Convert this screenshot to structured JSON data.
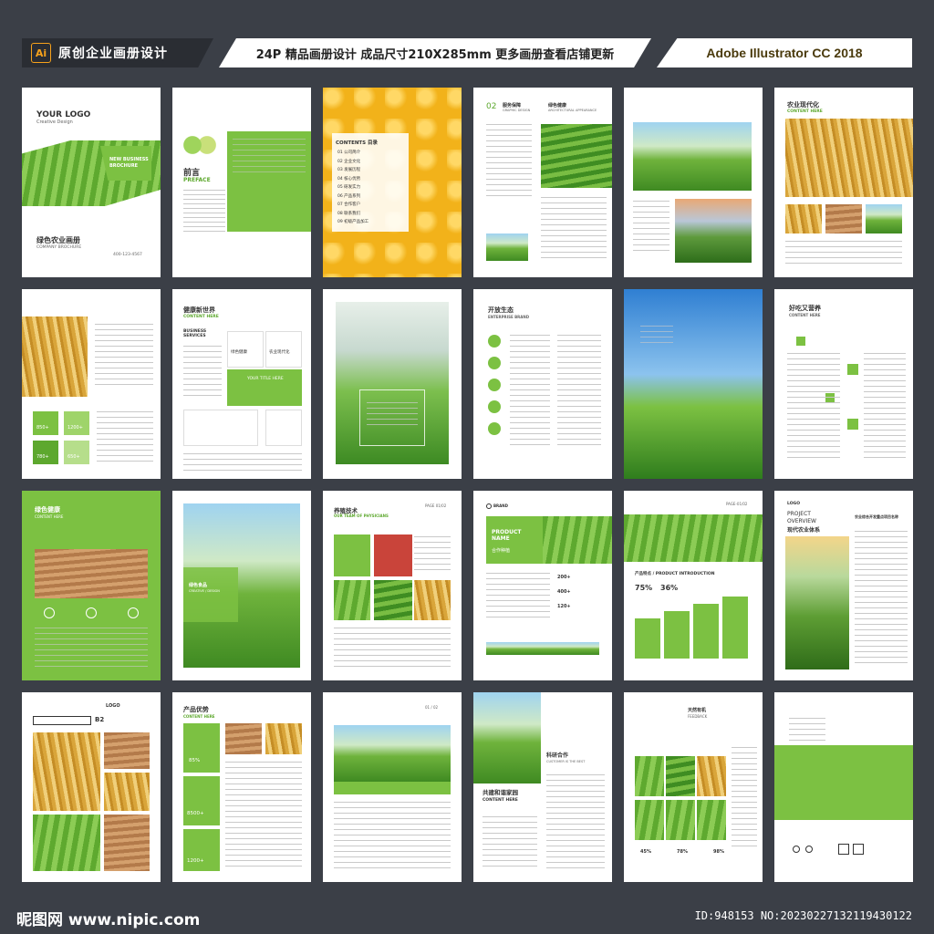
{
  "header": {
    "ai_badge": "Ai",
    "left_title": "原创企业画册设计",
    "center_text": "24P 精品画册设计 成品尺寸210X285mm 更多画册查看店铺更新",
    "right_text": "Adobe Illustrator CC 2018"
  },
  "pages": {
    "p1": {
      "logo": "YOUR LOGO",
      "logo_sub": "Creative Design",
      "badge": "NEW BUSINESS BROCHURE",
      "title": "绿色农业画册",
      "subtitle": "COMPANY BROCHURE",
      "phone": "400-123-4567"
    },
    "p2": {
      "cn": "前言",
      "en": "PREFACE"
    },
    "p3": {
      "heading": "CONTENTS 目录",
      "items": [
        "公司简介",
        "企业文化",
        "发展历程",
        "核心优势",
        "研发实力",
        "产品系列",
        "合作客户",
        "联系我们",
        "初级产品加工"
      ]
    },
    "p4": {
      "num": "02",
      "cn": "服务保障",
      "en": "GRAPHIC DESIGN",
      "cn2": "绿色健康",
      "en2": "ARCHITECTURAL APPEARANCE"
    },
    "p6": {
      "cn": "农业现代化",
      "en": "CONTENT HERE"
    },
    "p7": {
      "stats": [
        "850+",
        "1200+",
        "780+",
        "650+"
      ]
    },
    "p8": {
      "cn": "健康新世界",
      "en": "CONTENT HERE",
      "sub": "BUSINESS SERVICES",
      "box1": "绿色健康",
      "box2": "农业现代化",
      "box3": "YOUR TITLE HERE"
    },
    "p10": {
      "cn": "开放生态",
      "en": "ENTERPRISE BRAND"
    },
    "p12": {
      "cn": "好吃又营养",
      "en": "CONTENT HERE"
    },
    "p13": {
      "cn": "绿色健康",
      "en": "CONTENT HERE"
    },
    "p14": {
      "cn": "绿色食品",
      "en": "CREATIVE / DESIGN"
    },
    "p15": {
      "cn": "养殖技术",
      "en": "OUR TEAM OF PHYSICIANS",
      "page": "PAGE 01/02"
    },
    "p16": {
      "brand": "BRAND",
      "box": "PRODUCT NAME",
      "box_cn": "合作种植",
      "nums": [
        "200+",
        "400+",
        "120+"
      ]
    },
    "p17": {
      "page": "PAGE-01/02",
      "title": "产品特点 / PRODUCT INTRODUCTION",
      "pct1": "75%",
      "pct2": "36%"
    },
    "p18": {
      "logo": "LOGO",
      "title1": "PROJECT",
      "title2": "OVERVIEW",
      "title3": "现代农业体系",
      "side": "农业综合开发重点项目名称"
    },
    "p19": {
      "logo": "LOGO",
      "code": "B2"
    },
    "p20": {
      "cn": "产品优势",
      "en": "CONTENT HERE",
      "stats": [
        "85%",
        "8500+",
        "1200+"
      ]
    },
    "p21": {
      "page": "01 / 02"
    },
    "p22": {
      "cn": "共建和谐家园",
      "en": "CONTENT HERE",
      "side": "科研合作",
      "side_en": "CUSTOMER IS THE BEST"
    },
    "p23": {
      "cn": "天然有机",
      "en": "FEEDBACK",
      "pcts": [
        "45%",
        "78%",
        "98%"
      ]
    }
  },
  "footer": {
    "site": "昵图网 www.nipic.com",
    "id": "ID:948153 NO:20230227132119430122"
  }
}
